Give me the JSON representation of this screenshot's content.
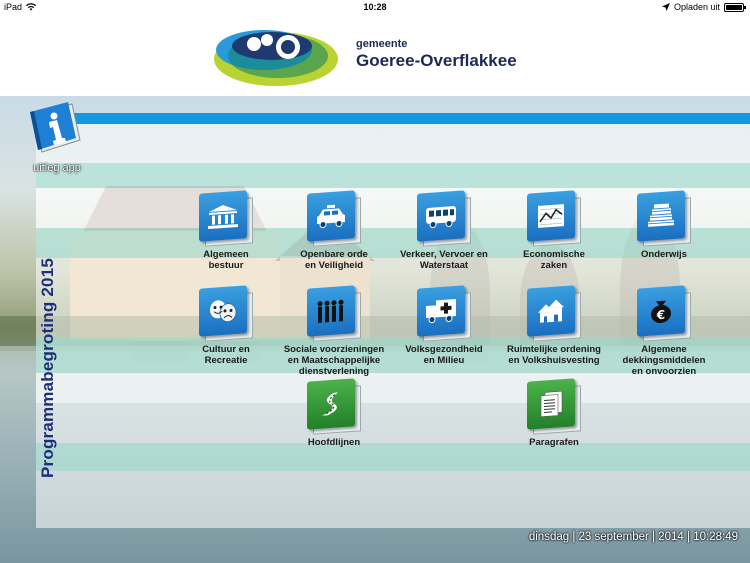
{
  "status_bar": {
    "device": "iPad",
    "time": "10:28",
    "charging_label": "Opladen uit",
    "battery_level": 1.0
  },
  "header": {
    "brand_small": "gemeente",
    "brand_name": "Goeree-Overflakkee"
  },
  "info_app": {
    "label": "uitleg app",
    "icon": "info-book-icon"
  },
  "vertical_title": "Programmabegroting 2015",
  "tiles": [
    {
      "label1": "Algemeen",
      "label2": "bestuur",
      "label3": "",
      "icon": "government-building-icon"
    },
    {
      "label1": "Openbare orde",
      "label2": "en Veiligheid",
      "label3": "",
      "icon": "police-car-icon"
    },
    {
      "label1": "Verkeer, Vervoer en",
      "label2": "Waterstaat",
      "label3": "",
      "icon": "bus-icon"
    },
    {
      "label1": "Economische",
      "label2": "zaken",
      "label3": "",
      "icon": "chart-icon"
    },
    {
      "label1": "Onderwijs",
      "label2": "",
      "label3": "",
      "icon": "books-icon"
    },
    {
      "label1": "Cultuur en",
      "label2": "Recreatie",
      "label3": "",
      "icon": "theater-masks-icon"
    },
    {
      "label1": "Sociale voorzieningen",
      "label2": "en Maatschappelijke",
      "label3": "dienstverlening",
      "icon": "people-icon"
    },
    {
      "label1": "Volksgezondheid",
      "label2": "en Milieu",
      "label3": "",
      "icon": "ambulance-icon"
    },
    {
      "label1": "Ruimtelijke ordening",
      "label2": "en Volkshuisvesting",
      "label3": "",
      "icon": "houses-icon"
    },
    {
      "label1": "Algemene",
      "label2": "dekkingsmiddelen",
      "label3": "en onvoorzien",
      "icon": "euro-bag-icon"
    },
    {
      "label1": "Hoofdlijnen",
      "label2": "",
      "label3": "",
      "icon": "road-icon"
    },
    {
      "label1": "Paragrafen",
      "label2": "",
      "label3": "",
      "icon": "documents-icon"
    }
  ],
  "footer": {
    "day": "dinsdag",
    "date": "23 september",
    "year": "2014",
    "time": "10:28:49",
    "separator": " | "
  },
  "colors": {
    "accent_blue": "#1398e2",
    "title_navy": "#1d2f78",
    "tile_blue": "#1a6fc0",
    "tile_green": "#22802a"
  }
}
